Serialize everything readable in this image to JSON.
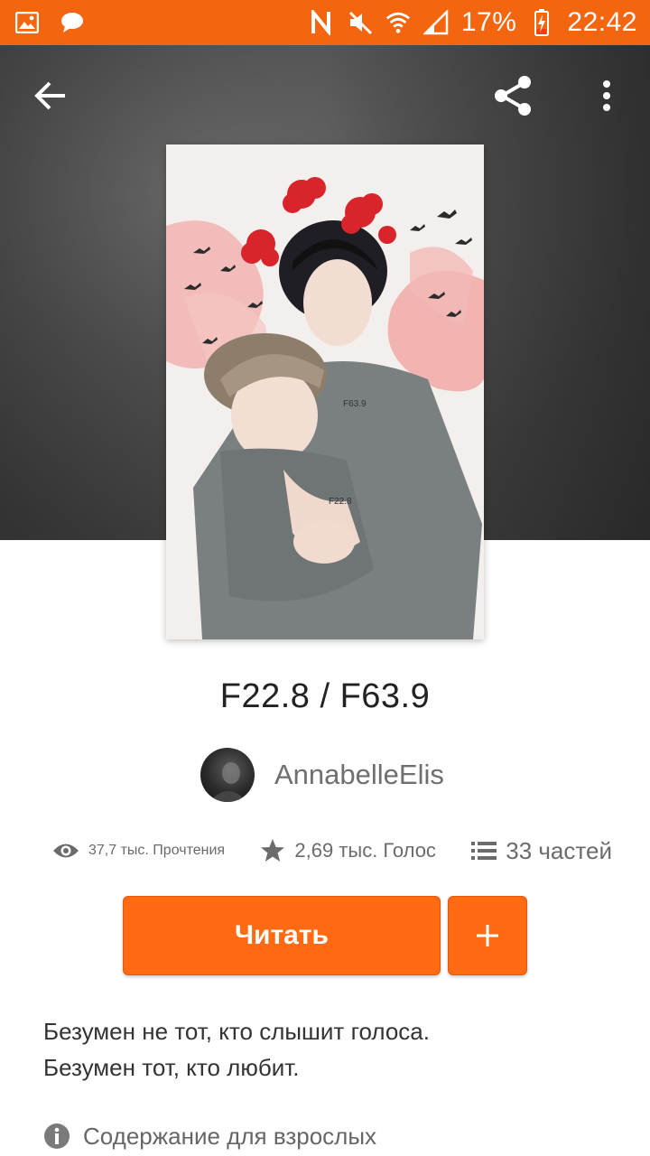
{
  "status_bar": {
    "battery_percent": "17%",
    "time": "22:42",
    "left_icons": [
      "gallery-icon",
      "chat-bubble-icon"
    ],
    "right_icons": [
      "nfc-icon",
      "mute-icon",
      "wifi-icon",
      "signal-icon",
      "battery-charging-icon"
    ]
  },
  "header": {
    "back_icon": "arrow-left-icon",
    "share_icon": "share-icon",
    "menu_icon": "more-vertical-icon"
  },
  "story": {
    "title": "F22.8 / F63.9",
    "cover_text_1": "F63.9",
    "cover_text_2": "F22.8",
    "author": "AnnabelleElis",
    "stats": {
      "reads": "37,7 тыс. Прочтения",
      "votes": "2,69 тыс. Голос",
      "parts": "33 частей"
    },
    "read_button": "Читать",
    "add_button": "+",
    "description_line1": "Безумен не тот, кто слышит голоса.",
    "description_line2": "Безумен тот, кто любит.",
    "mature_label": "Содержание для взрослых"
  },
  "colors": {
    "accent": "#ff6a13",
    "status_bar": "#f3650f"
  }
}
